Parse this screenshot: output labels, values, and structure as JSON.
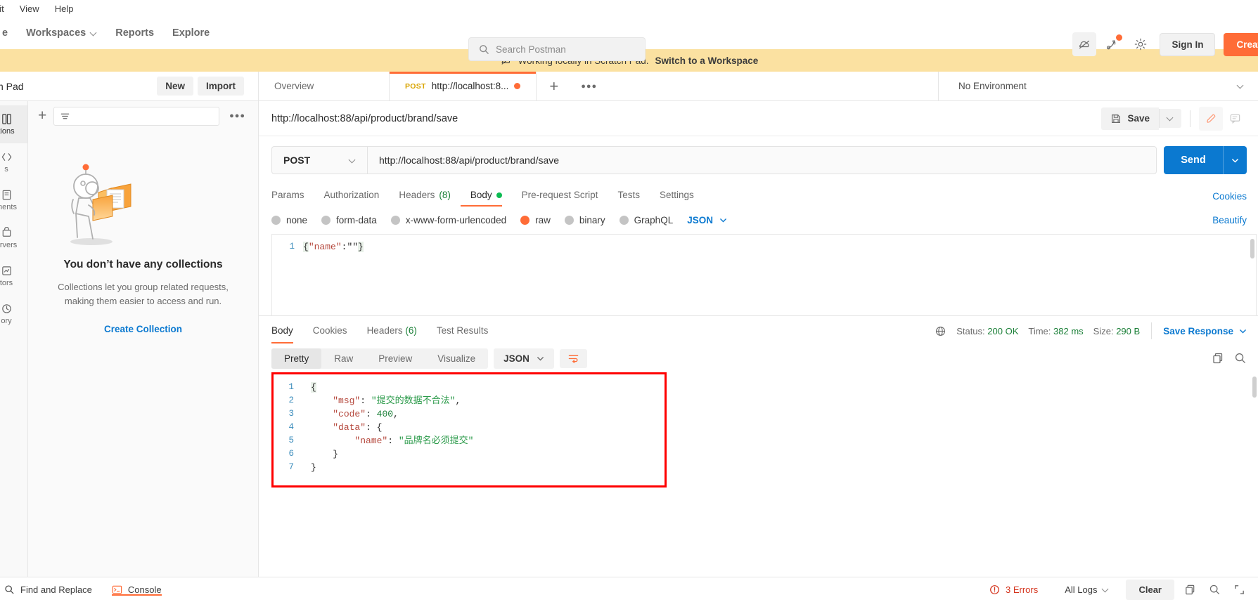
{
  "menubar": {
    "items": [
      "dit",
      "View",
      "Help"
    ]
  },
  "topnav": {
    "home_label": "e",
    "workspaces_label": "Workspaces",
    "reports_label": "Reports",
    "explore_label": "Explore",
    "search_placeholder": "Search Postman",
    "signin_label": "Sign In",
    "create_account_label": "Create Ac",
    "icons": {
      "cloud": "cloud-off-icon",
      "notifications": "notifications-icon",
      "settings": "gear-icon"
    }
  },
  "banner": {
    "text": "Working locally in Scratch Pad.",
    "link": "Switch to a Workspace"
  },
  "tabstrip": {
    "scratch_pad_label": "ch Pad",
    "new_label": "New",
    "import_label": "Import",
    "overview_label": "Overview",
    "request_tab": {
      "method": "POST",
      "title": "http://localhost:8..."
    },
    "environment_label": "No Environment"
  },
  "rail": {
    "items": [
      {
        "label": "tions",
        "icon": "collections-icon",
        "active": true
      },
      {
        "label": "s",
        "icon": "apis-icon",
        "active": false
      },
      {
        "label": "ments",
        "icon": "environments-icon",
        "active": false
      },
      {
        "label": "ervers",
        "icon": "mock-servers-icon",
        "active": false
      },
      {
        "label": "tors",
        "icon": "monitors-icon",
        "active": false
      },
      {
        "label": "ory",
        "icon": "history-icon",
        "active": false
      }
    ]
  },
  "collections": {
    "filter_placeholder": "",
    "empty_title": "You don’t have any collections",
    "empty_sub_line1": "Collections let you group related requests,",
    "empty_sub_line2": "making them easier to access and run.",
    "create_link": "Create Collection"
  },
  "request": {
    "title": "http://localhost:88/api/product/brand/save",
    "save_label": "Save",
    "method": "POST",
    "url": "http://localhost:88/api/product/brand/save",
    "send_label": "Send",
    "tabs": [
      {
        "label": "Params",
        "count": "",
        "active": false
      },
      {
        "label": "Authorization",
        "count": "",
        "active": false
      },
      {
        "label": "Headers",
        "count": "(8)",
        "active": false
      },
      {
        "label": "Body",
        "count": "",
        "active": true
      },
      {
        "label": "Pre-request Script",
        "count": "",
        "active": false
      },
      {
        "label": "Tests",
        "count": "",
        "active": false
      },
      {
        "label": "Settings",
        "count": "",
        "active": false
      }
    ],
    "cookies_link": "Cookies",
    "body_options": [
      {
        "label": "none",
        "selected": false
      },
      {
        "label": "form-data",
        "selected": false
      },
      {
        "label": "x-www-form-urlencoded",
        "selected": false
      },
      {
        "label": "raw",
        "selected": true
      },
      {
        "label": "binary",
        "selected": false
      },
      {
        "label": "GraphQL",
        "selected": false
      }
    ],
    "body_format": "JSON",
    "beautify_label": "Beautify",
    "editor": {
      "line_numbers": [
        "1"
      ],
      "content_open": "{",
      "content_key": "\"name\"",
      "content_colon": ":",
      "content_value": "\"\"",
      "content_close": "}"
    }
  },
  "response": {
    "tabs": [
      {
        "label": "Body",
        "count": "",
        "active": true
      },
      {
        "label": "Cookies",
        "count": "",
        "active": false
      },
      {
        "label": "Headers",
        "count": "(6)",
        "active": false
      },
      {
        "label": "Test Results",
        "count": "",
        "active": false
      }
    ],
    "status_label": "Status:",
    "status_value": "200 OK",
    "time_label": "Time:",
    "time_value": "382 ms",
    "size_label": "Size:",
    "size_value": "290 B",
    "save_response_label": "Save Response",
    "formats": [
      {
        "label": "Pretty",
        "active": true
      },
      {
        "label": "Raw",
        "active": false
      },
      {
        "label": "Preview",
        "active": false
      },
      {
        "label": "Visualize",
        "active": false
      }
    ],
    "format_type": "JSON",
    "line_numbers": [
      "1",
      "2",
      "3",
      "4",
      "5",
      "6",
      "7"
    ],
    "json": {
      "msg_key": "\"msg\"",
      "msg_value": "\"提交的数据不合法\"",
      "code_key": "\"code\"",
      "code_value": "400",
      "data_key": "\"data\"",
      "name_key": "\"name\"",
      "name_value": "\"品牌名必须提交\""
    }
  },
  "footer": {
    "find_replace_label": "Find and Replace",
    "console_label": "Console",
    "errors_label": "3 Errors",
    "all_logs_label": "All Logs",
    "clear_label": "Clear"
  },
  "colors": {
    "accent": "#ff6c37",
    "link": "#0b79d0",
    "success": "#1a7f37",
    "banner": "#fbe1a1",
    "highlight": "#ff0000",
    "send": "#0b79d0"
  }
}
